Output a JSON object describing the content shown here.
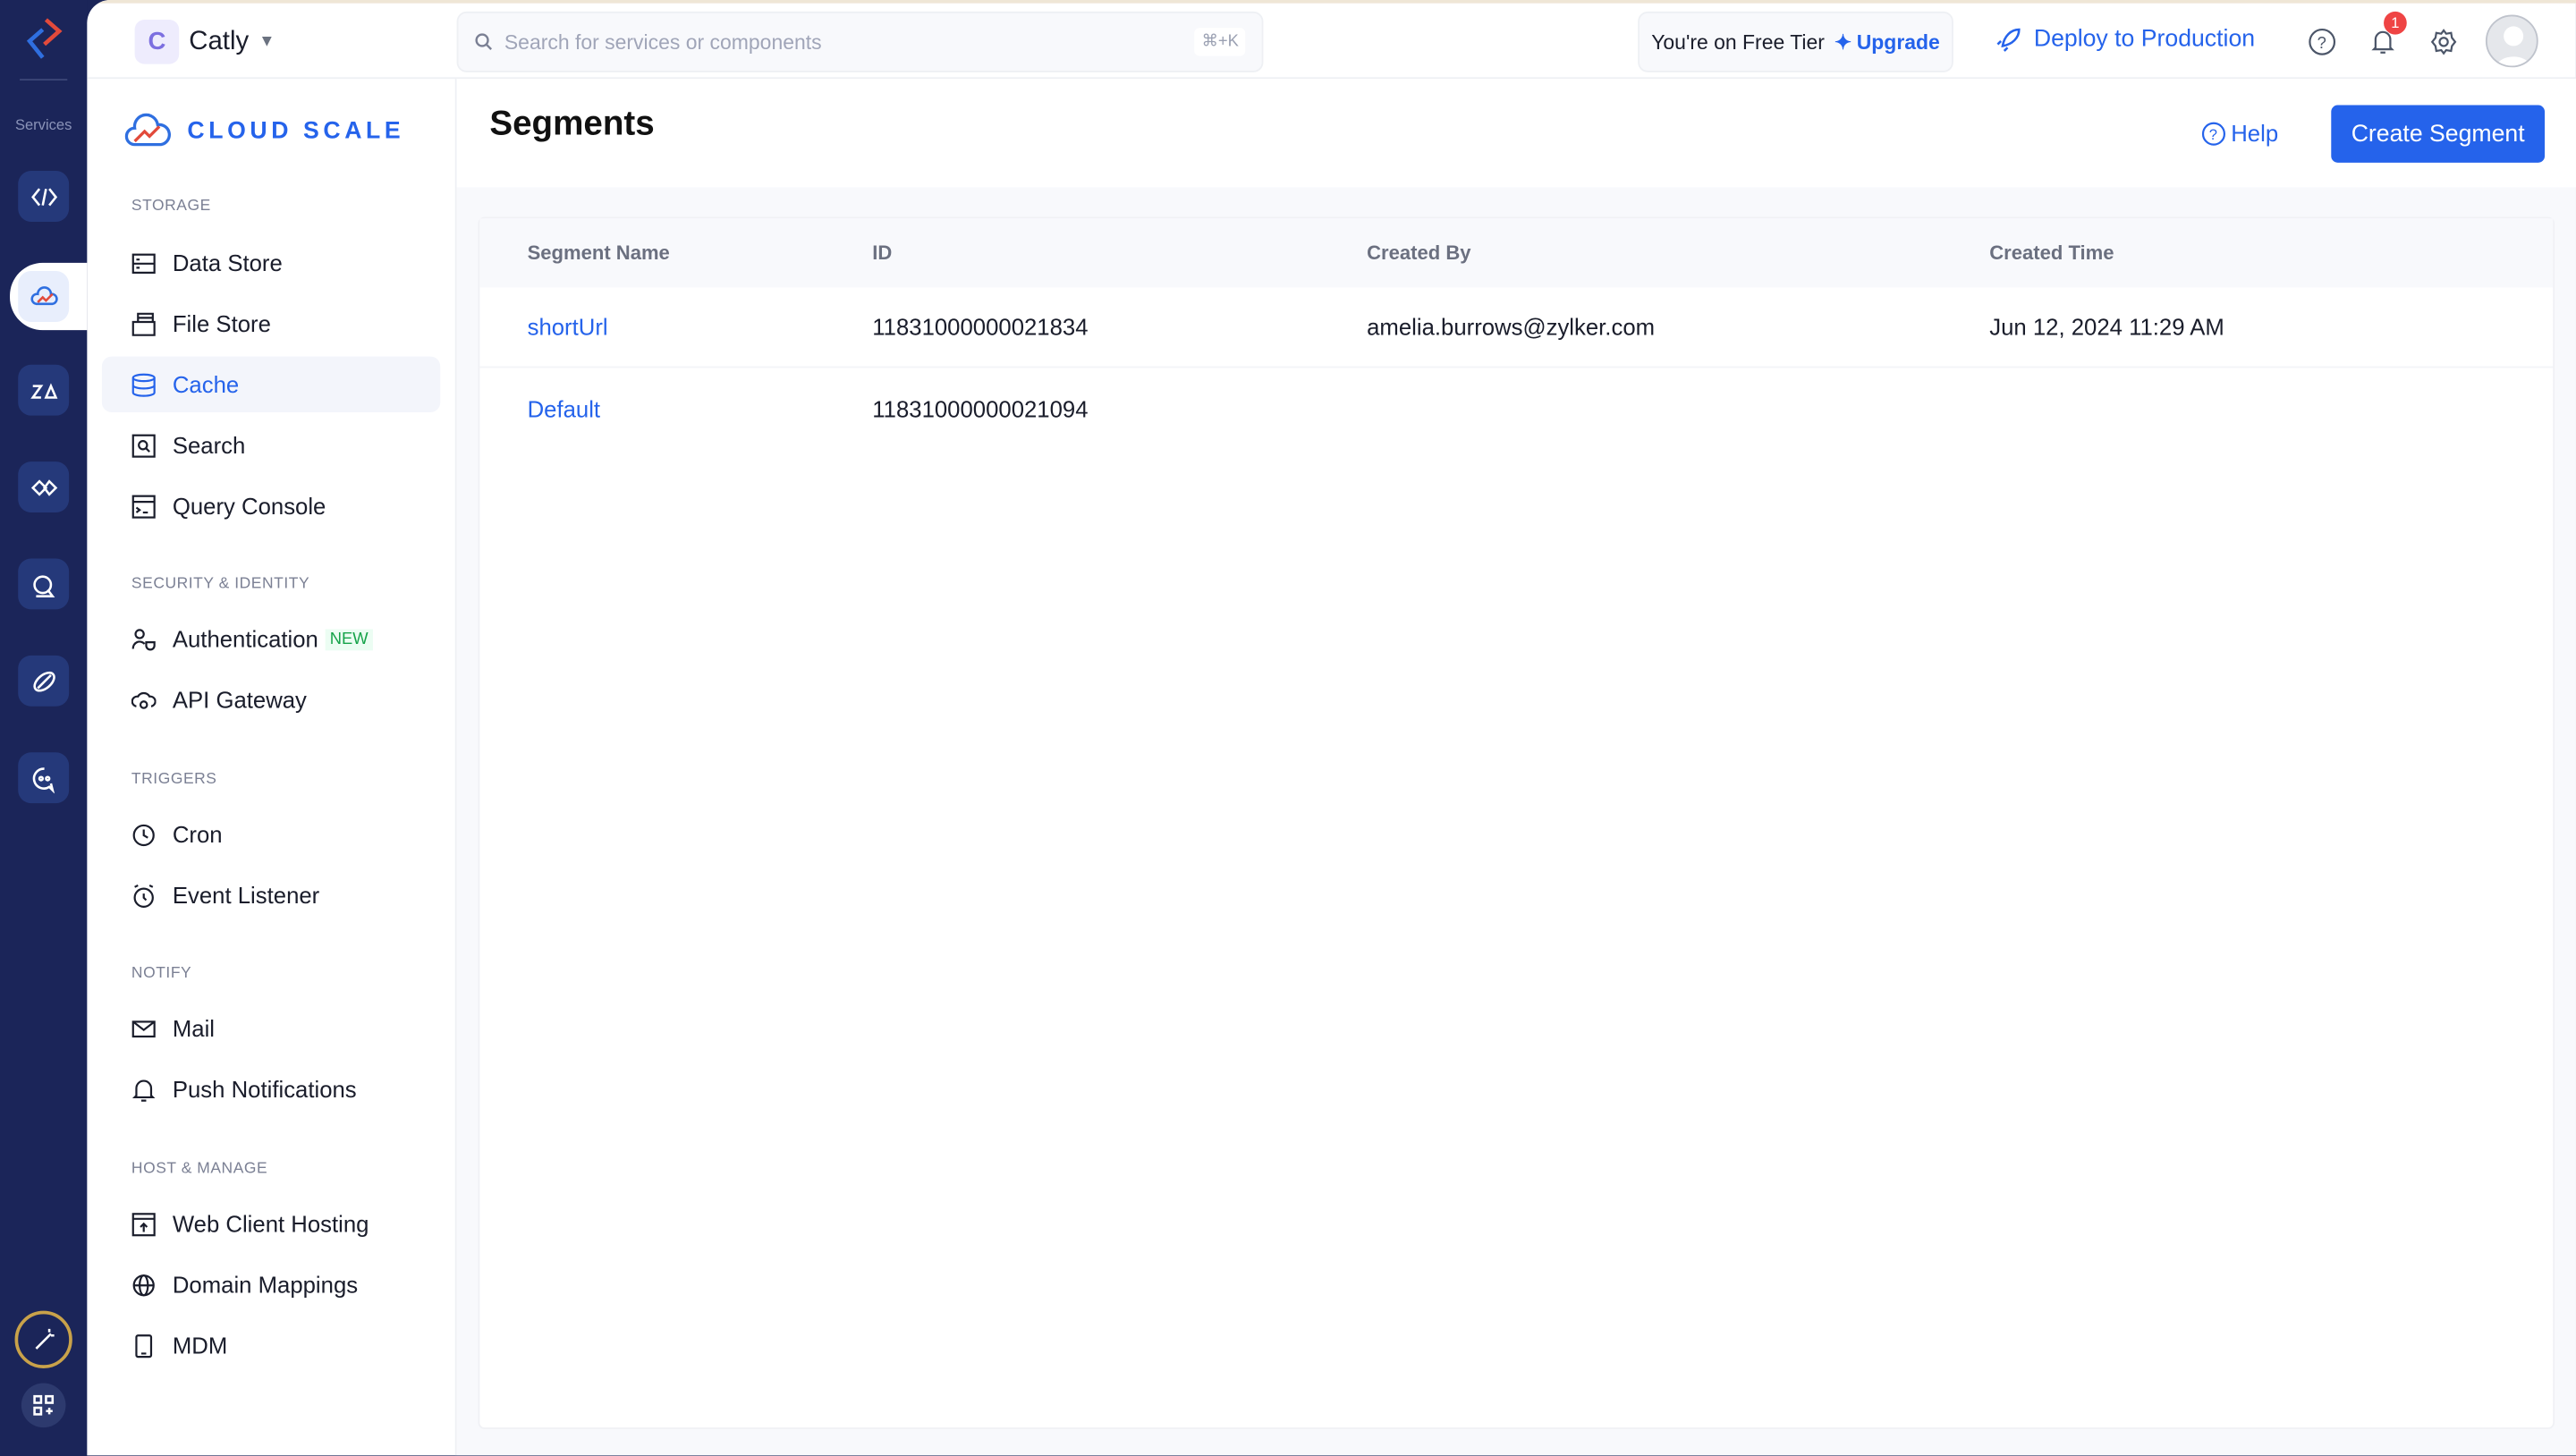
{
  "rail": {
    "services_label": "Services"
  },
  "topbar": {
    "project_initial": "C",
    "project_name": "Catly",
    "search_placeholder": "Search for services or components",
    "search_shortcut": "⌘+K",
    "tier_text": "You're on Free Tier",
    "upgrade_label": "Upgrade",
    "deploy_label": "Deploy to Production",
    "notification_count": "1"
  },
  "sidebar": {
    "brand": "CLOUD SCALE",
    "sections": [
      {
        "title": "STORAGE",
        "items": [
          "Data Store",
          "File Store",
          "Cache",
          "Search",
          "Query Console"
        ]
      },
      {
        "title": "SECURITY & IDENTITY",
        "items": [
          "Authentication",
          "API Gateway"
        ],
        "new_badge": "NEW"
      },
      {
        "title": "TRIGGERS",
        "items": [
          "Cron",
          "Event Listener"
        ]
      },
      {
        "title": "NOTIFY",
        "items": [
          "Mail",
          "Push Notifications"
        ]
      },
      {
        "title": "HOST & MANAGE",
        "items": [
          "Web Client Hosting",
          "Domain Mappings",
          "MDM"
        ]
      }
    ],
    "active_item": "Cache"
  },
  "page": {
    "title": "Segments",
    "help_label": "Help",
    "create_label": "Create Segment"
  },
  "table": {
    "columns": [
      "Segment Name",
      "ID",
      "Created By",
      "Created Time"
    ],
    "rows": [
      [
        "shortUrl",
        "11831000000021834",
        "amelia.burrows@zylker.com",
        "Jun 12, 2024 11:29 AM"
      ],
      [
        "Default",
        "11831000000021094",
        "",
        ""
      ]
    ]
  },
  "colors": {
    "accent": "#2563eb",
    "rail": "#1b2559"
  }
}
